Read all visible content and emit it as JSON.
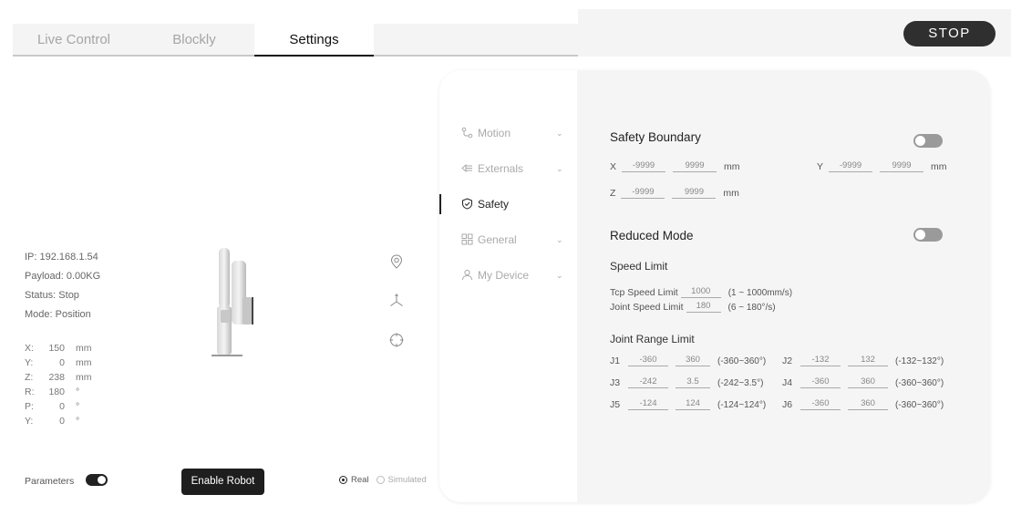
{
  "tabs": [
    {
      "label": "Live Control"
    },
    {
      "label": "Blockly"
    },
    {
      "label": "Settings"
    }
  ],
  "stop_label": "STOP",
  "status": {
    "ip": "IP: 192.168.1.54",
    "payload": "Payload: 0.00KG",
    "status": "Status: Stop",
    "mode": "Mode: Position"
  },
  "coords": [
    {
      "k": "X:",
      "v": "150",
      "u": "mm"
    },
    {
      "k": "Y:",
      "v": "0",
      "u": "mm"
    },
    {
      "k": "Z:",
      "v": "238",
      "u": "mm"
    },
    {
      "k": "R:",
      "v": "180",
      "u": "°"
    },
    {
      "k": "P:",
      "v": "0",
      "u": "°"
    },
    {
      "k": "Y:",
      "v": "0",
      "u": "°"
    }
  ],
  "bottom": {
    "parameters_label": "Parameters",
    "enable_label": "Enable Robot",
    "real_label": "Real",
    "simulated_label": "Simulated"
  },
  "nav": [
    {
      "label": "Motion",
      "icon": "motion-icon"
    },
    {
      "label": "Externals",
      "icon": "externals-icon"
    },
    {
      "label": "Safety",
      "icon": "shield-icon"
    },
    {
      "label": "General",
      "icon": "grid-icon"
    },
    {
      "label": "My Device",
      "icon": "user-icon"
    }
  ],
  "safety": {
    "boundary_title": "Safety Boundary",
    "x_label": "X",
    "x_min": "-9999",
    "x_max": "9999",
    "y_label": "Y",
    "y_min": "-9999",
    "y_max": "9999",
    "z_label": "Z",
    "z_min": "-9999",
    "z_max": "9999",
    "unit": "mm",
    "reduced_title": "Reduced Mode",
    "speed_title": "Speed Limit",
    "tcp_label": "Tcp Speed Limit",
    "tcp_value": "1000",
    "tcp_range": "(1 ~ 1000mm/s)",
    "joint_label": "Joint Speed Limit",
    "joint_value": "180",
    "joint_range": "(6 ~ 180°/s)",
    "joint_range_title": "Joint Range Limit",
    "joints": [
      {
        "name": "J1",
        "min": "-360",
        "max": "360",
        "range": "(-360~360°)"
      },
      {
        "name": "J2",
        "min": "-132",
        "max": "132",
        "range": "(-132~132°)"
      },
      {
        "name": "J3",
        "min": "-242",
        "max": "3.5",
        "range": "(-242~3.5°)"
      },
      {
        "name": "J4",
        "min": "-360",
        "max": "360",
        "range": "(-360~360°)"
      },
      {
        "name": "J5",
        "min": "-124",
        "max": "124",
        "range": "(-124~124°)"
      },
      {
        "name": "J6",
        "min": "-360",
        "max": "360",
        "range": "(-360~360°)"
      }
    ]
  }
}
